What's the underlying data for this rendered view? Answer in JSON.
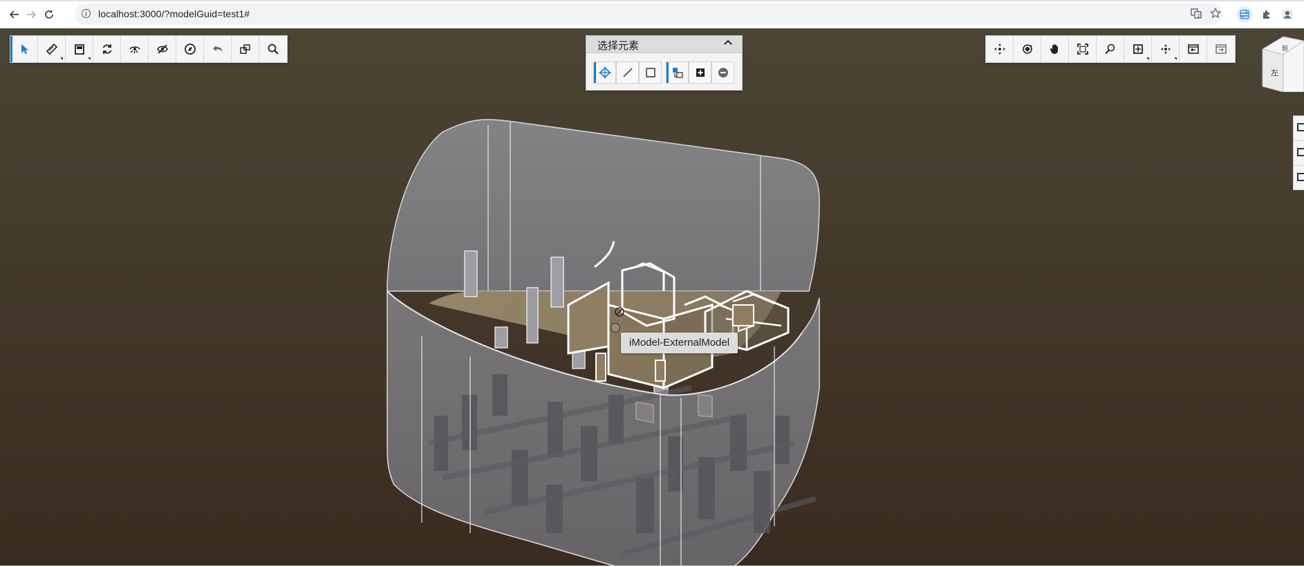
{
  "browser": {
    "back_icon": "back-arrow-icon",
    "forward_icon": "forward-arrow-icon",
    "reload_icon": "reload-icon",
    "url": "localhost:3000/?modelGuid=test1#",
    "translate_icon": "translate-icon",
    "bookmark_icon": "star-icon",
    "extensions": [
      "sync-extension-icon",
      "puzzle-extension-icon",
      "profile-avatar-icon"
    ]
  },
  "viewer": {
    "left_toolbar": [
      {
        "name": "select-tool",
        "icon": "cursor-arrow-icon",
        "selected": true
      },
      {
        "name": "measure-tool",
        "icon": "ruler-icon",
        "submenu": true
      },
      {
        "name": "section-tool",
        "icon": "section-box-icon",
        "submenu": true
      },
      {
        "name": "refresh-tool",
        "icon": "refresh-icon"
      },
      {
        "name": "hide-element-tool",
        "icon": "hide-eye-icon"
      },
      {
        "name": "isolate-tool",
        "icon": "eye-slash-icon"
      },
      {
        "name": "compass-tool",
        "icon": "compass-icon"
      },
      {
        "name": "undo-tool",
        "icon": "undo-icon"
      },
      {
        "name": "window-area-tool",
        "icon": "window-area-icon"
      },
      {
        "name": "search-tool",
        "icon": "magnifier-icon"
      }
    ],
    "select_panel": {
      "title": "选择元素",
      "collapse_icon": "chevron-up-icon",
      "modes": [
        {
          "name": "pick-point-mode",
          "icon": "point-select-icon",
          "selected": true
        },
        {
          "name": "line-mode",
          "icon": "line-select-icon"
        },
        {
          "name": "box-mode",
          "icon": "box-select-icon"
        }
      ],
      "operations": [
        {
          "name": "replace-selection",
          "icon": "replace-selection-icon",
          "selected": true
        },
        {
          "name": "add-to-selection",
          "icon": "plus-square-icon"
        },
        {
          "name": "remove-from-selection",
          "icon": "minus-circle-icon"
        }
      ]
    },
    "right_toolbar": [
      {
        "name": "rotate-view",
        "icon": "rotate-view-icon"
      },
      {
        "name": "orbit-view",
        "icon": "orbit-icon"
      },
      {
        "name": "pan-view",
        "icon": "hand-pan-icon"
      },
      {
        "name": "fit-view",
        "icon": "fit-view-icon"
      },
      {
        "name": "zoom-window",
        "icon": "zoom-window-icon"
      },
      {
        "name": "view-mode",
        "icon": "view-mode-icon",
        "submenu": true
      },
      {
        "name": "walk-view",
        "icon": "walk-icon",
        "submenu": true
      },
      {
        "name": "previous-view",
        "icon": "previous-view-icon"
      },
      {
        "name": "next-view",
        "icon": "next-view-icon"
      }
    ],
    "viewcube": {
      "top_face": "前",
      "side_face": "左"
    },
    "tooltip": "iModel-ExternalModel"
  },
  "colors": {
    "accent": "#1a7fc4",
    "background_top": "#4a4535",
    "background_bottom": "#3a2b1f",
    "toolbar_bg": "#f5f5f5"
  }
}
